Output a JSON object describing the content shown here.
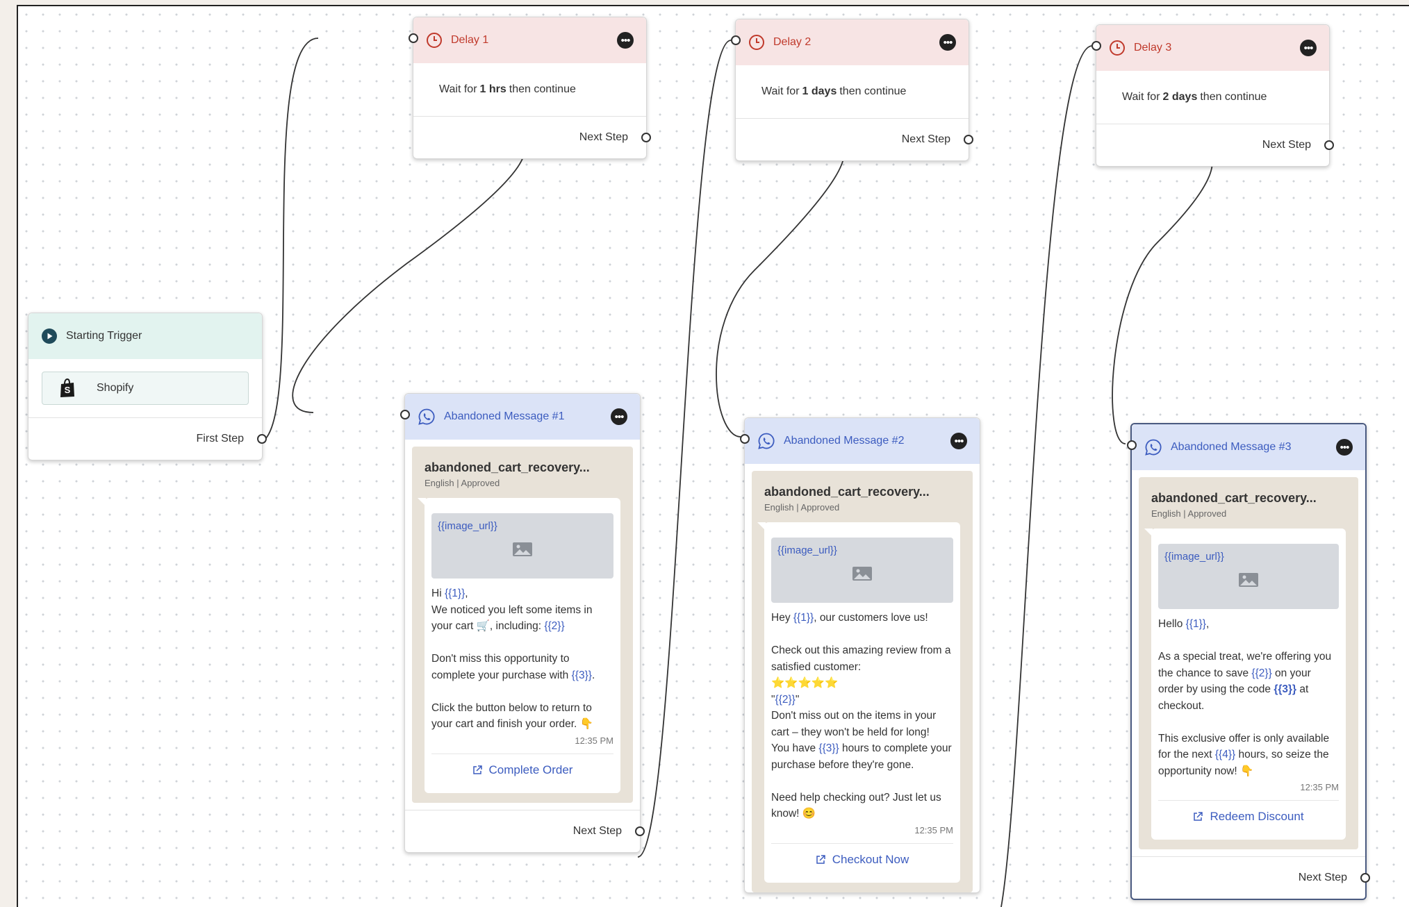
{
  "delays": [
    {
      "title": "Delay 1",
      "prefix": "Wait for",
      "amount": "1 hrs",
      "suffix": "then continue",
      "next": "Next Step"
    },
    {
      "title": "Delay 2",
      "prefix": "Wait for",
      "amount": "1 days",
      "suffix": "then continue",
      "next": "Next Step"
    },
    {
      "title": "Delay 3",
      "prefix": "Wait for",
      "amount": "2 days",
      "suffix": "then continue",
      "next": "Next Step"
    }
  ],
  "trigger": {
    "title": "Starting Trigger",
    "source": "Shopify",
    "next": "First Step"
  },
  "messages": [
    {
      "title": "Abandoned Message #1",
      "template": "abandoned_cart_recovery...",
      "meta": "English | Approved",
      "image_var": "{{image_url}}",
      "body": [
        {
          "t": "Hi "
        },
        {
          "v": "{{1}}"
        },
        {
          "t": ",\nWe noticed you left some items in your cart 🛒, including: "
        },
        {
          "v": "{{2}}"
        },
        {
          "t": "\n\nDon't miss this opportunity to complete your purchase with "
        },
        {
          "v": "{{3}}"
        },
        {
          "t": ".\n\nClick the button below to return to your cart and finish your order. 👇"
        }
      ],
      "time": "12:35 PM",
      "cta": "Complete Order",
      "next": "Next Step"
    },
    {
      "title": "Abandoned Message #2",
      "template": "abandoned_cart_recovery...",
      "meta": "English | Approved",
      "image_var": "{{image_url}}",
      "body": [
        {
          "t": "Hey "
        },
        {
          "v": "{{1}}"
        },
        {
          "t": ", our customers love us!\n\nCheck out this amazing review from a satisfied customer:\n⭐⭐⭐⭐⭐\n\""
        },
        {
          "v": "{{2}}"
        },
        {
          "t": "\"\nDon't miss out on the items in your cart – they won't be held for long!\nYou have "
        },
        {
          "v": "{{3}}"
        },
        {
          "t": " hours to complete your purchase before they're gone.\n\nNeed help checking out? Just let us know! 😊"
        }
      ],
      "time": "12:35 PM",
      "cta": "Checkout Now"
    },
    {
      "title": "Abandoned Message #3",
      "template": "abandoned_cart_recovery...",
      "meta": "English | Approved",
      "image_var": "{{image_url}}",
      "body": [
        {
          "t": "Hello "
        },
        {
          "v": "{{1}}"
        },
        {
          "t": ",\n\nAs a special treat, we're offering you the chance to save "
        },
        {
          "v": "{{2}}"
        },
        {
          "t": " on your order by using the code "
        },
        {
          "vb": "{{3}}"
        },
        {
          "t": " at checkout.\n\nThis exclusive offer is only available for the next "
        },
        {
          "v": "{{4}}"
        },
        {
          "t": " hours, so seize the opportunity now! 👇"
        }
      ],
      "time": "12:35 PM",
      "cta": "Redeem Discount",
      "next": "Next Step"
    }
  ],
  "colors": {
    "delay_header": "#f7e4e4",
    "delay_accent": "#c0392b",
    "trigger_header": "#e2f3ef",
    "message_header": "#dbe3f7",
    "message_accent": "#3c5cbf",
    "whatsapp_bg": "#e8e2d8"
  }
}
